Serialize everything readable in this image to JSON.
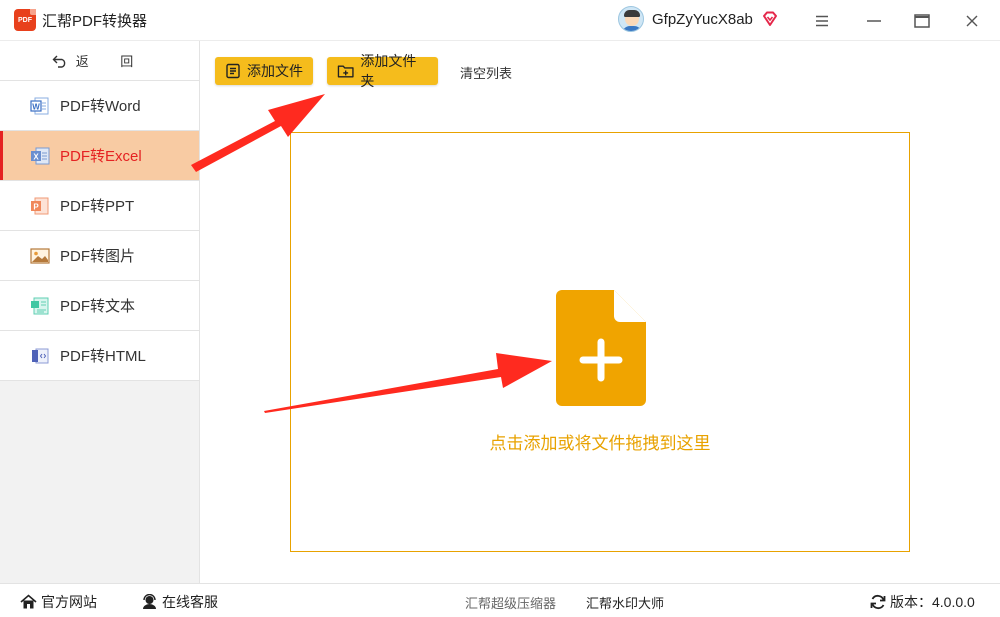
{
  "app": {
    "title": "汇帮PDF转换器",
    "logo_text": "PDF"
  },
  "user": {
    "name": "GfpZyYucX8ab"
  },
  "window_controls": {
    "menu": "≡",
    "minimize": "—",
    "maximize": "▭",
    "close": "✕"
  },
  "sidebar": {
    "back_label": "返 回",
    "items": [
      {
        "label": "PDF转Word",
        "icon": "word-icon",
        "active": false
      },
      {
        "label": "PDF转Excel",
        "icon": "excel-icon",
        "active": true
      },
      {
        "label": "PDF转PPT",
        "icon": "ppt-icon",
        "active": false
      },
      {
        "label": "PDF转图片",
        "icon": "image-icon",
        "active": false
      },
      {
        "label": "PDF转文本",
        "icon": "text-icon",
        "active": false
      },
      {
        "label": "PDF转HTML",
        "icon": "html-icon",
        "active": false
      }
    ]
  },
  "toolbar": {
    "add_file": "添加文件",
    "add_folder": "添加文件夹",
    "clear_list": "清空列表"
  },
  "dropzone": {
    "hint": "点击添加或将文件拖拽到这里"
  },
  "statusbar": {
    "website": "官方网站",
    "support": "在线客服",
    "compressor": "汇帮超级压缩器",
    "watermark": "汇帮水印大师",
    "version": "版本：4.0.0.0"
  },
  "colors": {
    "accent": "#f5bc1c",
    "active_bg": "#f8cba3",
    "active_text": "#e52222",
    "drop_orange": "#e8a200",
    "annotation_arrow": "#ff2a1f"
  }
}
